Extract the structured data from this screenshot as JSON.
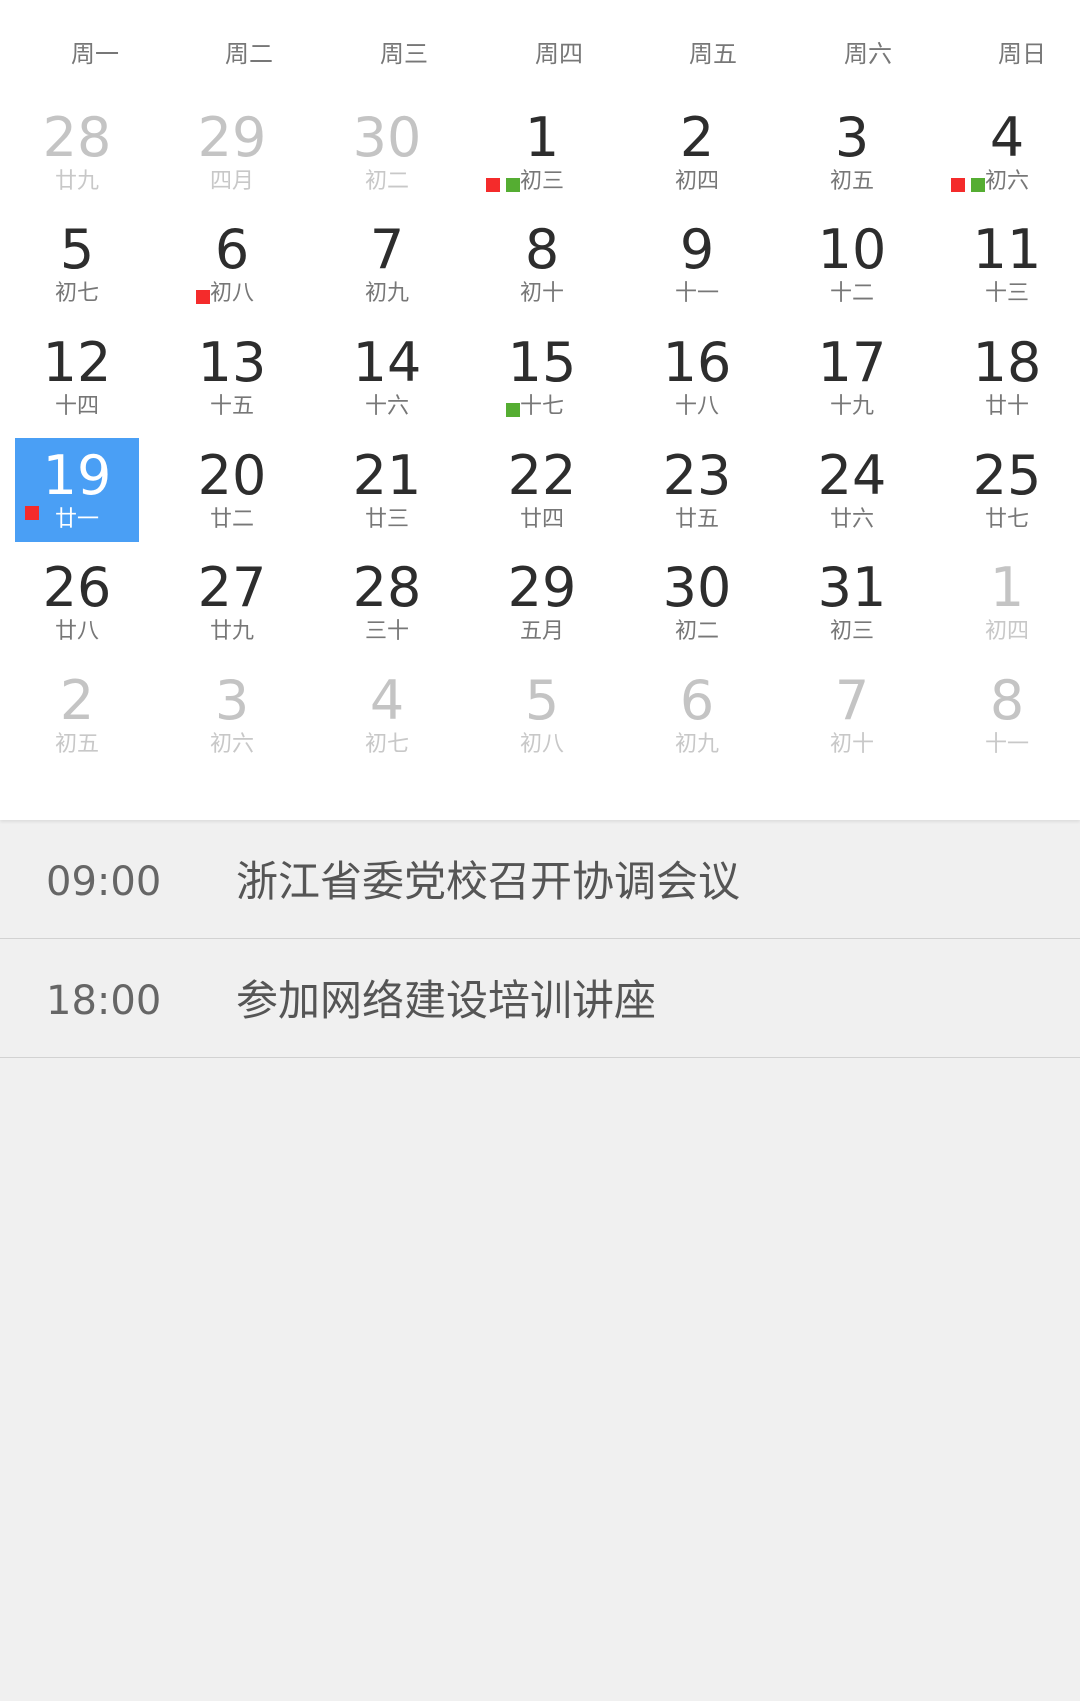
{
  "colors": {
    "accent": "#4a9ff5",
    "dot_red": "#f42b2b",
    "dot_green": "#55ad32"
  },
  "weekdays": [
    "周一",
    "周二",
    "周三",
    "周四",
    "周五",
    "周六",
    "周日"
  ],
  "weeks": [
    [
      {
        "day": "28",
        "lunar": "廿九",
        "other": true
      },
      {
        "day": "29",
        "lunar": "四月",
        "other": true
      },
      {
        "day": "30",
        "lunar": "初二",
        "other": true
      },
      {
        "day": "1",
        "lunar": "初三",
        "dots": [
          "red",
          "green"
        ]
      },
      {
        "day": "2",
        "lunar": "初四"
      },
      {
        "day": "3",
        "lunar": "初五"
      },
      {
        "day": "4",
        "lunar": "初六",
        "dots": [
          "red",
          "green"
        ]
      }
    ],
    [
      {
        "day": "5",
        "lunar": "初七"
      },
      {
        "day": "6",
        "lunar": "初八",
        "dots": [
          "red"
        ]
      },
      {
        "day": "7",
        "lunar": "初九"
      },
      {
        "day": "8",
        "lunar": "初十"
      },
      {
        "day": "9",
        "lunar": "十一"
      },
      {
        "day": "10",
        "lunar": "十二"
      },
      {
        "day": "11",
        "lunar": "十三"
      }
    ],
    [
      {
        "day": "12",
        "lunar": "十四"
      },
      {
        "day": "13",
        "lunar": "十五"
      },
      {
        "day": "14",
        "lunar": "十六"
      },
      {
        "day": "15",
        "lunar": "十七",
        "dots": [
          "green"
        ]
      },
      {
        "day": "16",
        "lunar": "十八"
      },
      {
        "day": "17",
        "lunar": "十九"
      },
      {
        "day": "18",
        "lunar": "廿十"
      }
    ],
    [
      {
        "day": "19",
        "lunar": "廿一",
        "selected": true,
        "dots": [
          "red"
        ]
      },
      {
        "day": "20",
        "lunar": "廿二"
      },
      {
        "day": "21",
        "lunar": "廿三"
      },
      {
        "day": "22",
        "lunar": "廿四"
      },
      {
        "day": "23",
        "lunar": "廿五"
      },
      {
        "day": "24",
        "lunar": "廿六"
      },
      {
        "day": "25",
        "lunar": "廿七"
      }
    ],
    [
      {
        "day": "26",
        "lunar": "廿八"
      },
      {
        "day": "27",
        "lunar": "廿九"
      },
      {
        "day": "28",
        "lunar": "三十"
      },
      {
        "day": "29",
        "lunar": "五月"
      },
      {
        "day": "30",
        "lunar": "初二"
      },
      {
        "day": "31",
        "lunar": "初三"
      },
      {
        "day": "1",
        "lunar": "初四",
        "other": true
      }
    ],
    [
      {
        "day": "2",
        "lunar": "初五",
        "other": true
      },
      {
        "day": "3",
        "lunar": "初六",
        "other": true
      },
      {
        "day": "4",
        "lunar": "初七",
        "other": true
      },
      {
        "day": "5",
        "lunar": "初八",
        "other": true
      },
      {
        "day": "6",
        "lunar": "初九",
        "other": true
      },
      {
        "day": "7",
        "lunar": "初十",
        "other": true
      },
      {
        "day": "8",
        "lunar": "十一",
        "other": true
      }
    ]
  ],
  "events": [
    {
      "time": "09:00",
      "title": "浙江省委党校召开协调会议"
    },
    {
      "time": "18:00",
      "title": "参加网络建设培训讲座"
    }
  ]
}
